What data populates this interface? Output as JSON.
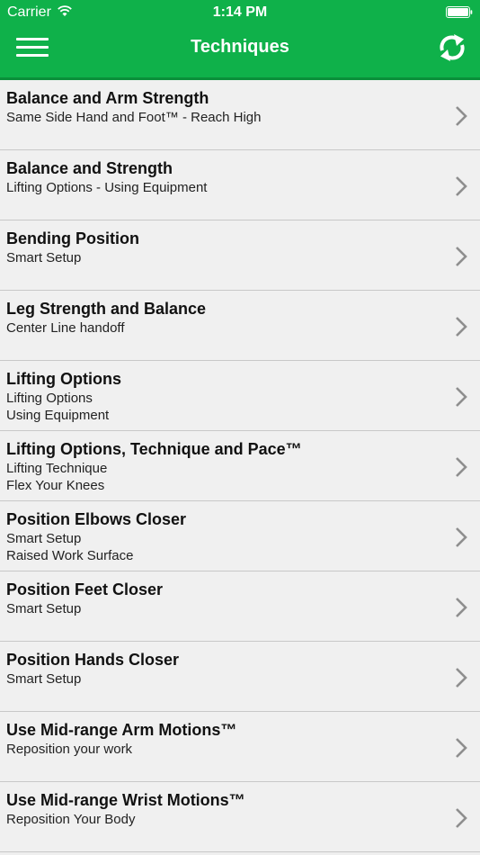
{
  "status_bar": {
    "carrier": "Carrier",
    "time": "1:14 PM"
  },
  "header": {
    "title": "Techniques",
    "menu_icon": "hamburger-menu-icon",
    "refresh_icon": "refresh-icon",
    "background_color": "#0fb14a"
  },
  "list": {
    "items": [
      {
        "title": "Balance and Arm Strength",
        "lines": [
          "Same Side Hand and Foot™ - Reach High"
        ]
      },
      {
        "title": "Balance and Strength",
        "lines": [
          "Lifting Options - Using Equipment"
        ]
      },
      {
        "title": "Bending Position",
        "lines": [
          "Smart Setup"
        ]
      },
      {
        "title": "Leg Strength and Balance",
        "lines": [
          "Center Line handoff"
        ]
      },
      {
        "title": "Lifting Options",
        "lines": [
          "Lifting Options",
          "Using Equipment"
        ]
      },
      {
        "title": "Lifting Options, Technique and Pace™",
        "lines": [
          "Lifting Technique",
          "Flex Your Knees"
        ]
      },
      {
        "title": "Position Elbows Closer",
        "lines": [
          "Smart Setup",
          "Raised Work Surface"
        ]
      },
      {
        "title": "Position Feet Closer",
        "lines": [
          "Smart Setup"
        ]
      },
      {
        "title": "Position Hands Closer",
        "lines": [
          "Smart Setup"
        ]
      },
      {
        "title": "Use Mid-range Arm Motions™",
        "lines": [
          "Reposition your work"
        ]
      },
      {
        "title": "Use Mid-range Wrist Motions™",
        "lines": [
          "Reposition Your Body"
        ]
      }
    ]
  }
}
